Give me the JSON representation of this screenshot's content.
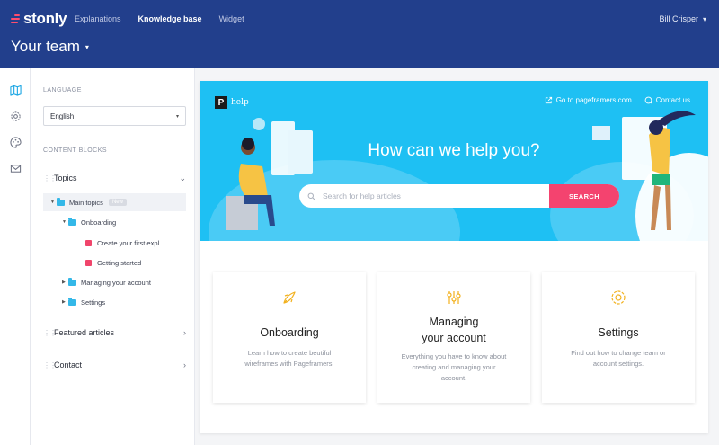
{
  "app": {
    "logo": "stonly",
    "nav": [
      {
        "label": "Explanations",
        "active": false
      },
      {
        "label": "Knowledge base",
        "active": true
      },
      {
        "label": "Widget",
        "active": false
      }
    ],
    "user": "Bill Crisper",
    "team": "Your team",
    "colors": {
      "header": "#223f8c",
      "brand_accent": "#ff4d6d",
      "hero": "#1ec0f3",
      "search_button": "#f4436f"
    }
  },
  "rail": {
    "icons": [
      "map-icon",
      "gear-icon",
      "palette-icon",
      "mail-icon"
    ]
  },
  "sidebar": {
    "language_label": "LANGUAGE",
    "language_value": "English",
    "content_blocks_label": "CONTENT BLOCKS",
    "topics_label": "Topics",
    "tree": {
      "main_topics": "Main topics",
      "main_topics_badge": "New",
      "onboarding": "Onboarding",
      "doc_1": "Create your first expl...",
      "doc_2": "Getting started",
      "managing": "Managing your account",
      "settings": "Settings"
    },
    "featured_label": "Featured articles",
    "contact_label": "Contact"
  },
  "preview": {
    "brand_letter": "P",
    "brand_name": "help",
    "link_site": "Go to pageframers.com",
    "link_contact": "Contact us",
    "title": "How can we help you?",
    "search_placeholder": "Search for help articles",
    "search_button": "SEARCH",
    "cards": [
      {
        "title_line1": "Onboarding",
        "title_line2": "",
        "desc": "Learn how to create beutiful wireframes with Pageframers.",
        "icon": "rocket-icon"
      },
      {
        "title_line1": "Managing",
        "title_line2": "your account",
        "desc": "Everything you have to know about creating and managing your account.",
        "icon": "sliders-icon"
      },
      {
        "title_line1": "Settings",
        "title_line2": "",
        "desc": "Find out how to change team or account settings.",
        "icon": "gear-icon"
      }
    ]
  }
}
